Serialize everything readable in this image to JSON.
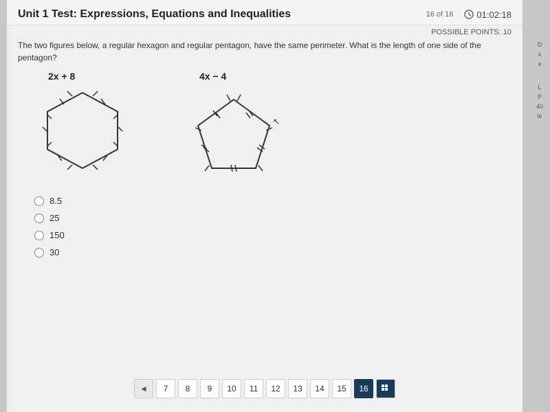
{
  "header": {
    "title": "Unit 1 Test: Expressions, Equations and Inequalities",
    "progress": "16 of 16",
    "timer": "01:02:18"
  },
  "question": {
    "possible_points": "POSSIBLE POINTS: 10",
    "text": "The two figures below, a regular hexagon and regular pentagon, have the same perimeter. What is the length of one side of the pentagon?",
    "hexagon_label": "2x + 8",
    "pentagon_label": "4x − 4"
  },
  "answers": [
    {
      "id": "a",
      "value": "8.5"
    },
    {
      "id": "b",
      "value": "25"
    },
    {
      "id": "c",
      "value": "150"
    },
    {
      "id": "d",
      "value": "30"
    }
  ],
  "navigation": {
    "arrow_left": "◄",
    "pages": [
      "7",
      "8",
      "9",
      "10",
      "11",
      "12",
      "13",
      "14",
      "15",
      "16"
    ],
    "current_page": "16"
  },
  "right_panel": {
    "labels": [
      "D",
      "x",
      "x",
      "L",
      "P",
      "40",
      "le"
    ]
  }
}
